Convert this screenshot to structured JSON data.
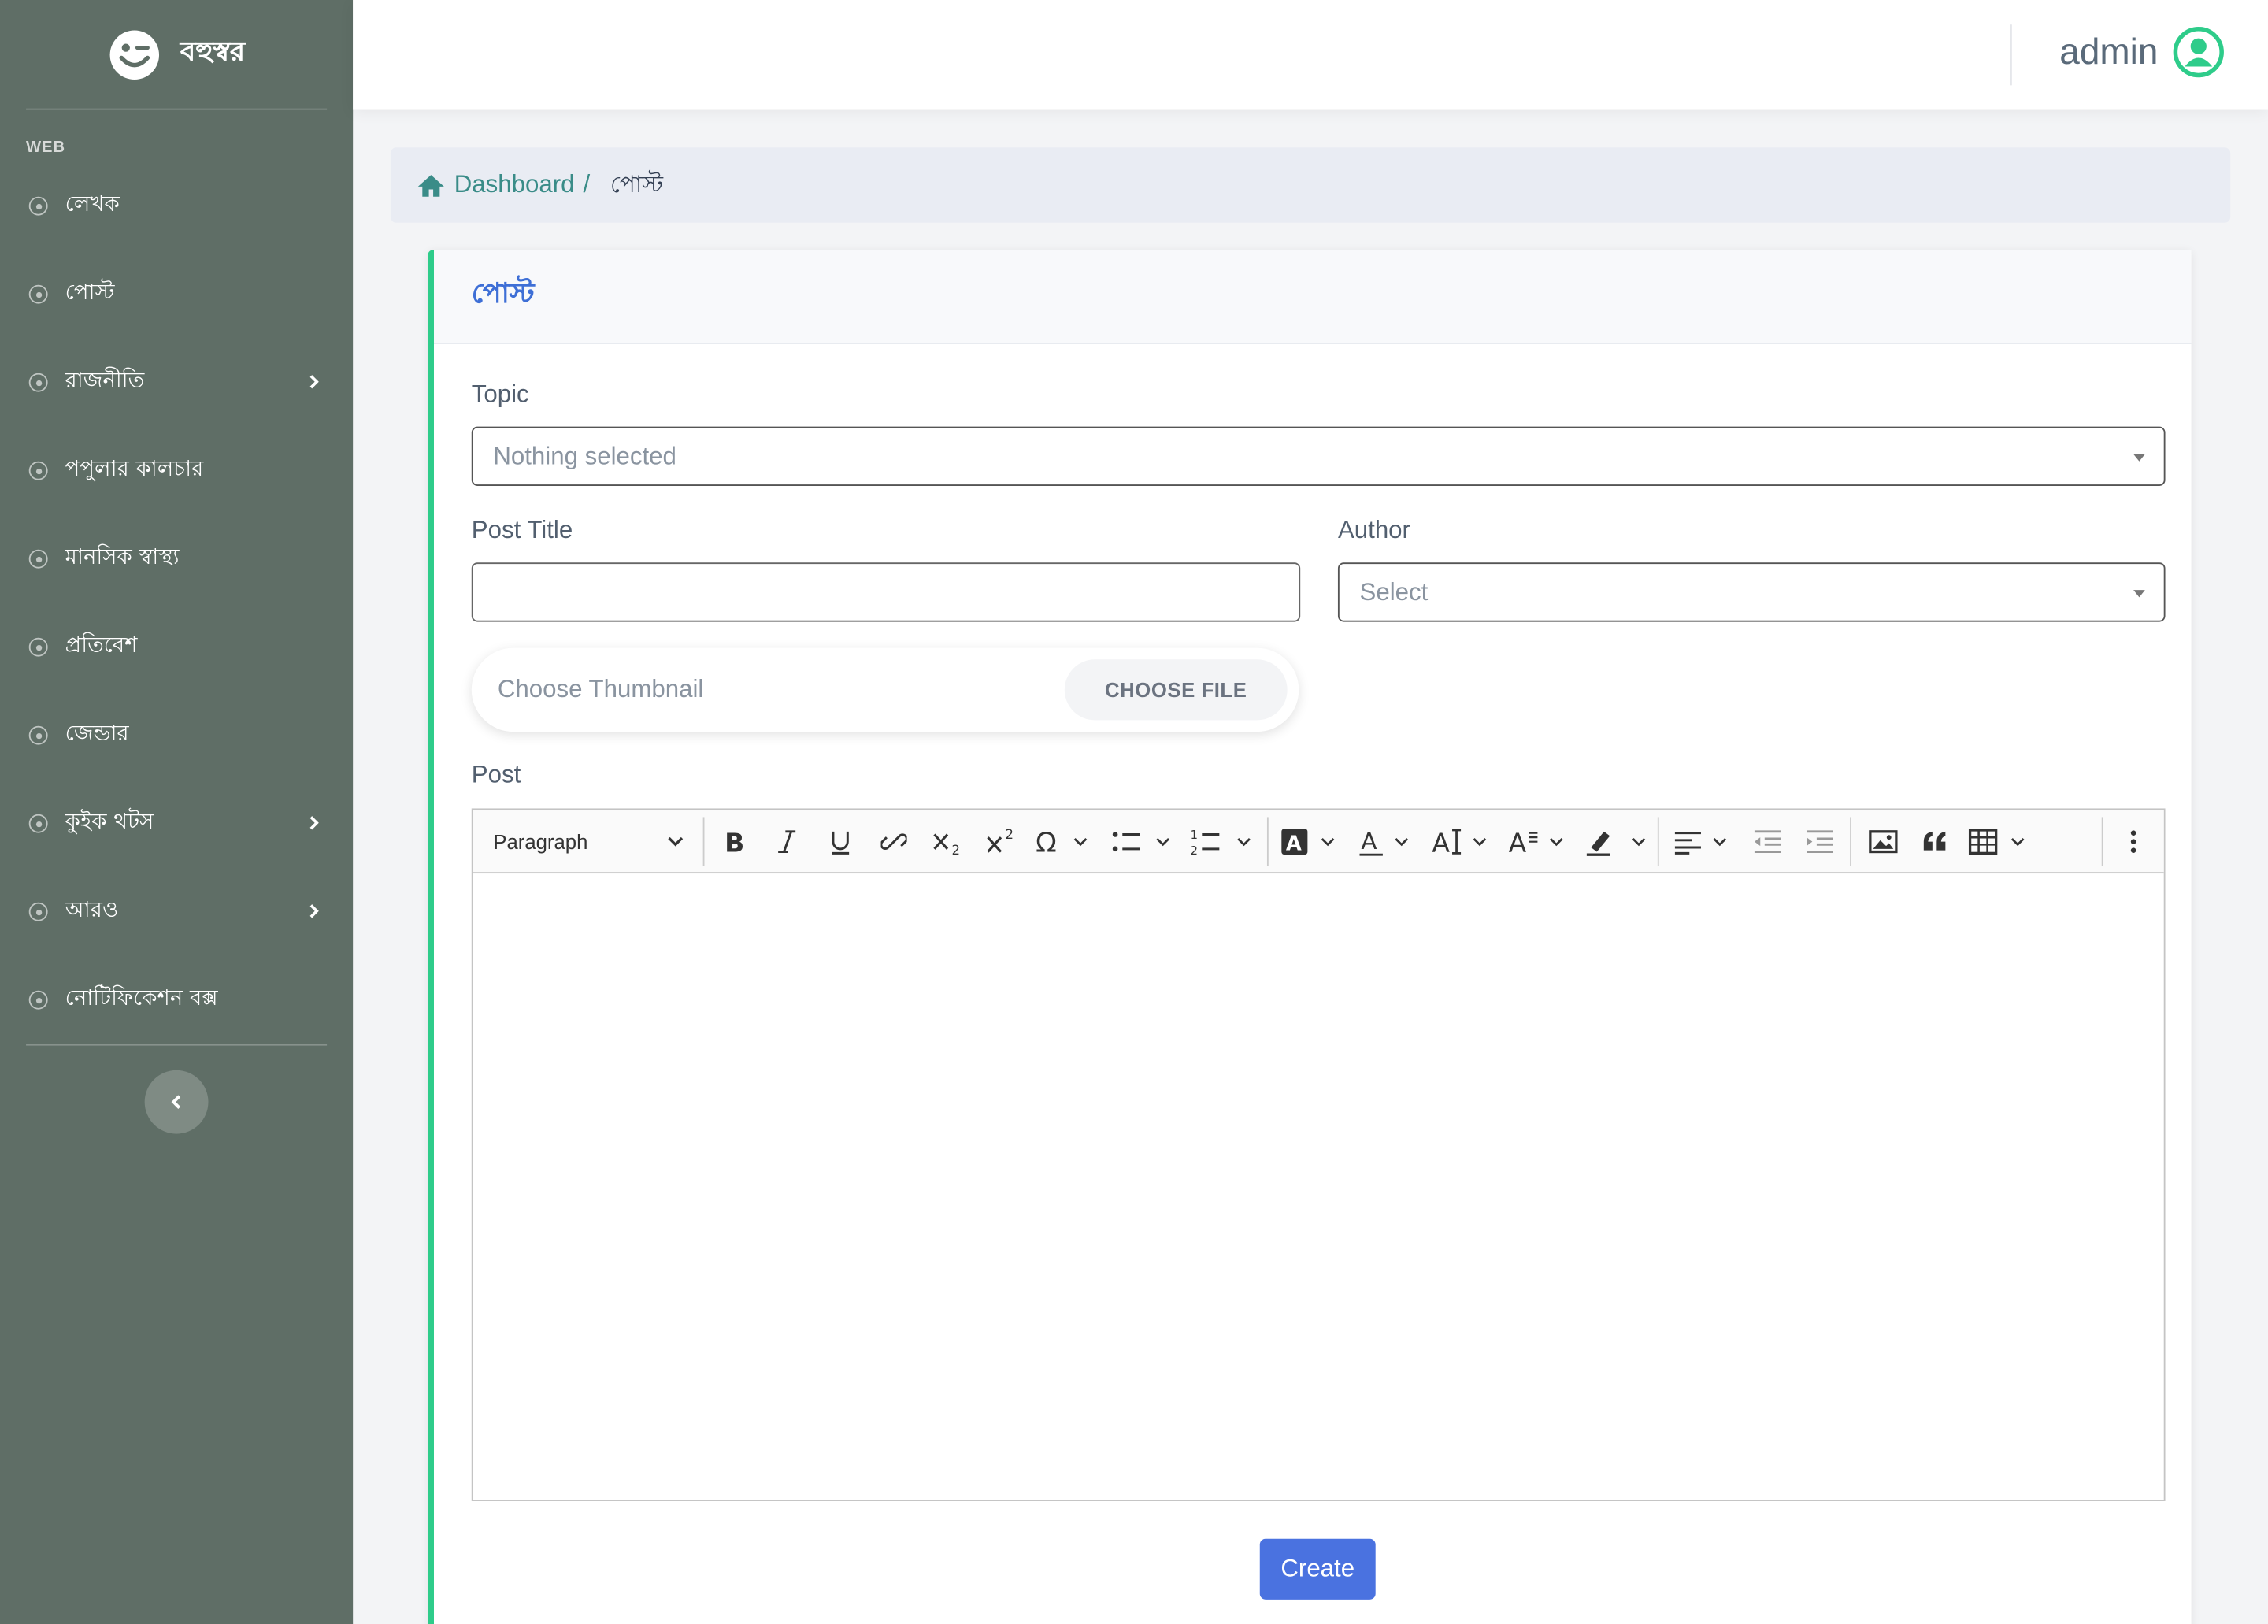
{
  "brand": {
    "name": "বহুস্বর"
  },
  "sidebar": {
    "heading": "WEB",
    "items": [
      {
        "label": "লেখক",
        "has_children": false
      },
      {
        "label": "পোস্ট",
        "has_children": false
      },
      {
        "label": "রাজনীতি",
        "has_children": true
      },
      {
        "label": "পপুলার কালচার",
        "has_children": false
      },
      {
        "label": "মানসিক স্বাস্থ্য",
        "has_children": false
      },
      {
        "label": "প্রতিবেশ",
        "has_children": false
      },
      {
        "label": "জেন্ডার",
        "has_children": false
      },
      {
        "label": "কুইক থটস",
        "has_children": true
      },
      {
        "label": "আরও",
        "has_children": true
      },
      {
        "label": "নোটিফিকেশন বক্স",
        "has_children": false
      }
    ]
  },
  "topbar": {
    "user_name": "admin"
  },
  "breadcrumb": {
    "home": "Dashboard",
    "separator": "/",
    "current": "পোস্ট"
  },
  "card": {
    "title": "পোস্ট",
    "topic": {
      "label": "Topic",
      "placeholder": "Nothing selected"
    },
    "post_title": {
      "label": "Post Title",
      "value": ""
    },
    "author": {
      "label": "Author",
      "placeholder": "Select"
    },
    "thumbnail": {
      "placeholder": "Choose Thumbnail",
      "button": "CHOOSE FILE"
    },
    "post": {
      "label": "Post",
      "paragraph_style": "Paragraph",
      "content": ""
    },
    "submit": "Create"
  },
  "colors": {
    "sidebar_bg": "#5f6e66",
    "card_accent": "#2ecc8a",
    "title_blue": "#3e6fd6",
    "button_blue": "#4a72e0",
    "breadcrumb_link": "#3a8c88",
    "avatar_green": "#2ecc8a"
  },
  "icons": [
    "logo-wink-icon",
    "circle-dot-icon",
    "chevron-right-icon",
    "chevron-left-icon",
    "user-circle-icon",
    "home-icon",
    "bold-icon",
    "italic-icon",
    "underline-icon",
    "link-icon",
    "subscript-icon",
    "superscript-icon",
    "special-char-icon",
    "bulleted-list-icon",
    "numbered-list-icon",
    "font-background-icon",
    "font-color-icon",
    "font-size-icon",
    "font-family-icon",
    "highlight-icon",
    "align-icon",
    "outdent-icon",
    "indent-icon",
    "image-icon",
    "blockquote-icon",
    "table-icon",
    "more-vertical-icon"
  ]
}
